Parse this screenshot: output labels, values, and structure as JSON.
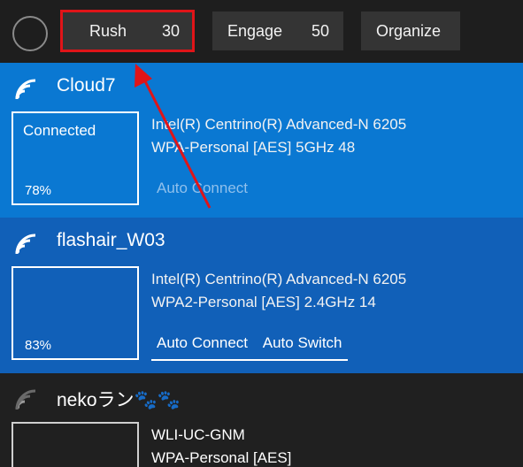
{
  "toolbar": {
    "rush_label": "Rush",
    "rush_value": "30",
    "engage_label": "Engage",
    "engage_value": "50",
    "organize_label": "Organize"
  },
  "networks": [
    {
      "ssid": "Cloud7",
      "status": "Connected",
      "signal": "78%",
      "adapter": "Intel(R) Centrino(R) Advanced-N 6205",
      "security": "WPA-Personal [AES] 5GHz 48",
      "options": [
        "Auto Connect"
      ]
    },
    {
      "ssid": "flashair_W03",
      "status": "",
      "signal": "83%",
      "adapter": "Intel(R) Centrino(R) Advanced-N 6205",
      "security": "WPA2-Personal [AES] 2.4GHz 14",
      "options": [
        "Auto Connect",
        "Auto Switch"
      ]
    },
    {
      "ssid": "nekoラン🐾🐾",
      "status": "",
      "signal": "",
      "adapter": "WLI-UC-GNM",
      "security": "WPA-Personal [AES]",
      "options": []
    }
  ],
  "colors": {
    "connected_bg": "#0a78d2",
    "selected_bg": "#1160b8",
    "idle_bg": "#202020",
    "highlight_annotation": "#e01418"
  }
}
